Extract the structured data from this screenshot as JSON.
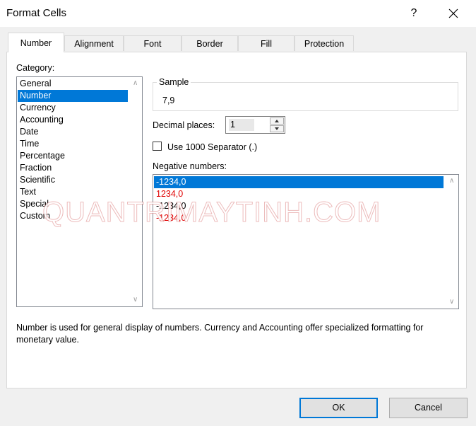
{
  "window": {
    "title": "Format Cells",
    "help_label": "?",
    "close_icon": "close-icon"
  },
  "tabs": [
    {
      "label": "Number",
      "active": true
    },
    {
      "label": "Alignment",
      "active": false
    },
    {
      "label": "Font",
      "active": false
    },
    {
      "label": "Border",
      "active": false
    },
    {
      "label": "Fill",
      "active": false
    },
    {
      "label": "Protection",
      "active": false
    }
  ],
  "category": {
    "label": "Category:",
    "items": [
      "General",
      "Number",
      "Currency",
      "Accounting",
      "Date",
      "Time",
      "Percentage",
      "Fraction",
      "Scientific",
      "Text",
      "Special",
      "Custom"
    ],
    "selected": "Number"
  },
  "sample": {
    "label": "Sample",
    "value": "7,9"
  },
  "decimal_places": {
    "label": "Decimal places:",
    "value": "1"
  },
  "separator": {
    "label": "Use 1000 Separator (.)",
    "checked": false
  },
  "negative_numbers": {
    "label": "Negative numbers:",
    "items": [
      {
        "text": "-1234,0",
        "color": "#000000",
        "selected": true
      },
      {
        "text": "1234,0",
        "color": "#e00000",
        "selected": false
      },
      {
        "text": "-1234,0",
        "color": "#000000",
        "selected": false
      },
      {
        "text": "-1234,0",
        "color": "#e00000",
        "selected": false
      }
    ]
  },
  "description": "Number is used for general display of numbers.  Currency and Accounting offer specialized formatting for monetary value.",
  "watermark": "QUANTRIMAYTINH.COM",
  "buttons": {
    "ok": "OK",
    "cancel": "Cancel"
  },
  "colors": {
    "selection": "#0078d7",
    "negative_red": "#e00000"
  }
}
